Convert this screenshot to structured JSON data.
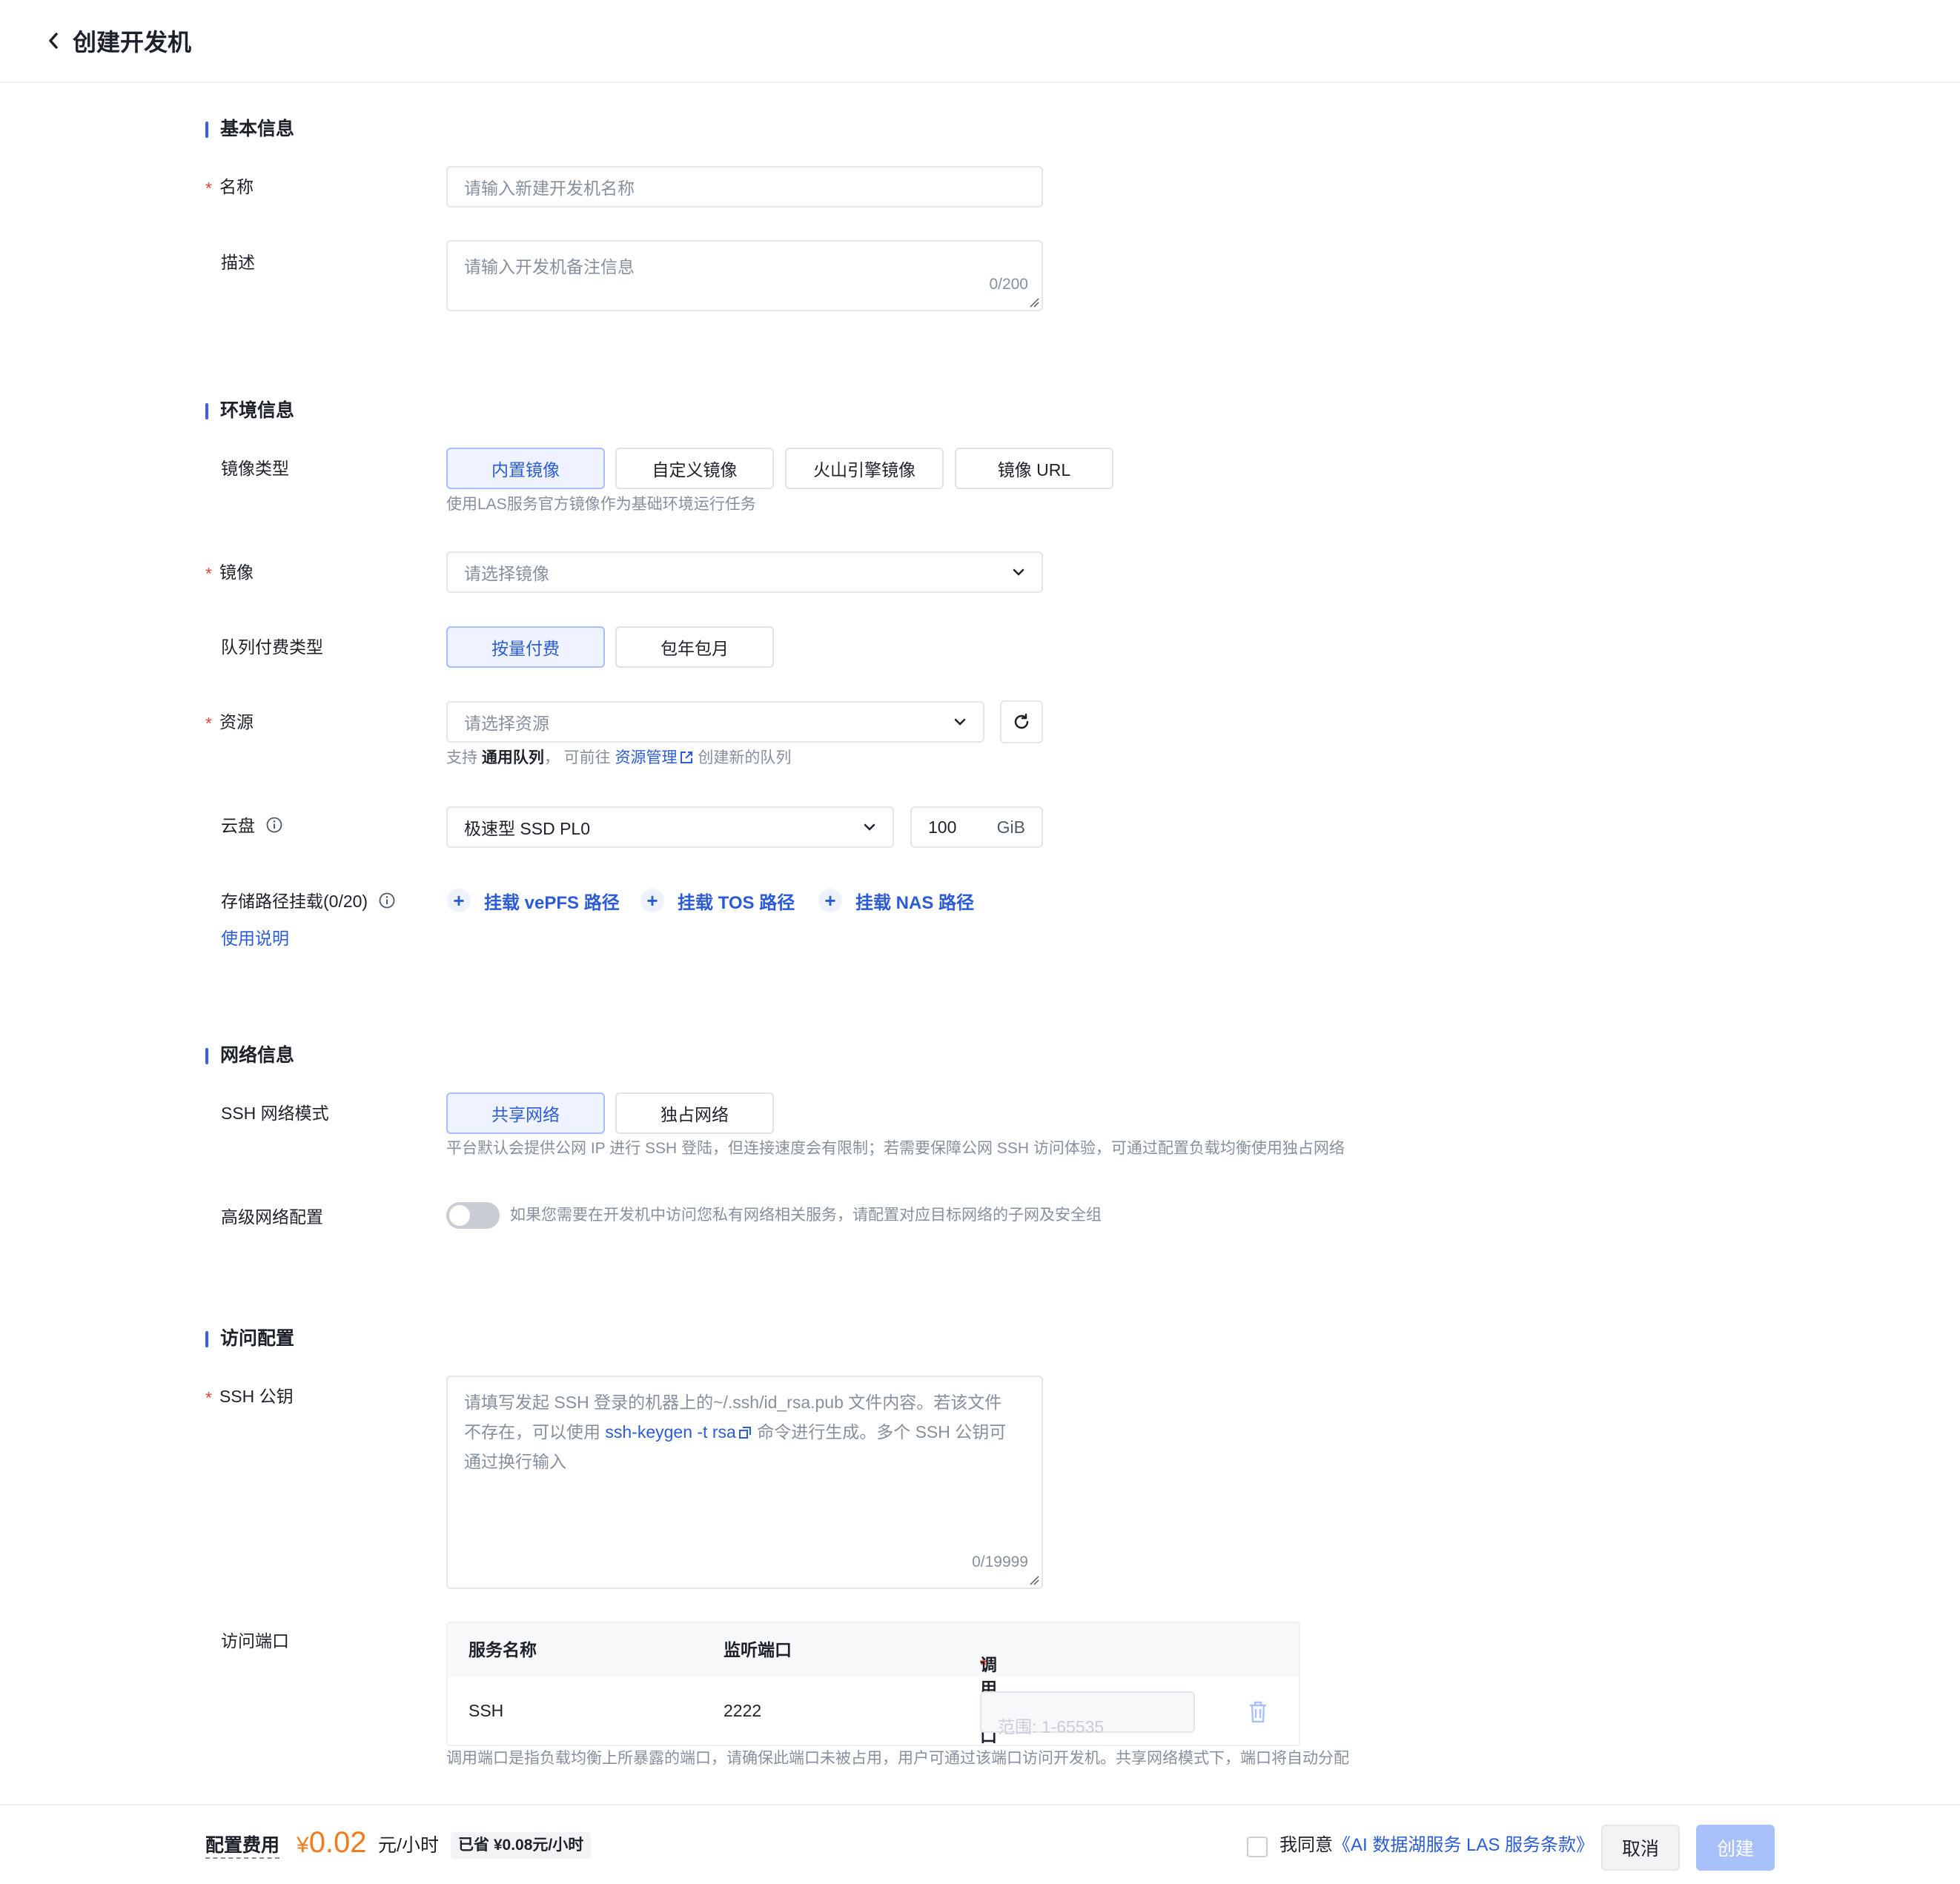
{
  "header": {
    "title": "创建开发机"
  },
  "sections": {
    "basic": "基本信息",
    "env": "环境信息",
    "network": "网络信息",
    "access": "访问配置"
  },
  "basic": {
    "name_label": "名称",
    "name_placeholder": "请输入新建开发机名称",
    "desc_label": "描述",
    "desc_placeholder": "请输入开发机备注信息",
    "desc_counter": "0/200"
  },
  "env": {
    "image_type_label": "镜像类型",
    "image_types": [
      "内置镜像",
      "自定义镜像",
      "火山引擎镜像",
      "镜像 URL"
    ],
    "image_type_hint": "使用LAS服务官方镜像作为基础环境运行任务",
    "image_label": "镜像",
    "image_placeholder": "请选择镜像",
    "billing_label": "队列付费类型",
    "billing_types": [
      "按量付费",
      "包年包月"
    ],
    "resource_label": "资源",
    "resource_placeholder": "请选择资源",
    "resource_hint_prefix": "支持",
    "resource_hint_bold": "通用队列",
    "resource_hint_mid": "， 可前往",
    "resource_hint_link": "资源管理",
    "resource_hint_suffix": "创建新的队列",
    "disk_label": "云盘",
    "disk_type": "极速型 SSD PL0",
    "disk_size": "100",
    "disk_unit": "GiB",
    "storage_label": "存储路径挂载(0/20)",
    "storage_help": "使用说明",
    "mounts": [
      "挂载 vePFS 路径",
      "挂载 TOS 路径",
      "挂载 NAS 路径"
    ]
  },
  "network": {
    "ssh_mode_label": "SSH 网络模式",
    "ssh_modes": [
      "共享网络",
      "独占网络"
    ],
    "ssh_mode_hint": "平台默认会提供公网 IP 进行 SSH 登陆，但连接速度会有限制；若需要保障公网 SSH 访问体验，可通过配置负载均衡使用独占网络",
    "advanced_label": "高级网络配置",
    "advanced_hint": "如果您需要在开发机中访问您私有网络相关服务，请配置对应目标网络的子网及安全组"
  },
  "access": {
    "ssh_key_label": "SSH 公钥",
    "ssh_key_placeholder_1": "请填写发起 SSH 登录的机器上的~/.ssh/id_rsa.pub 文件内容。若该文件",
    "ssh_key_placeholder_2a": "不存在，可以使用",
    "ssh_key_placeholder_link": "ssh-keygen -t rsa",
    "ssh_key_placeholder_2b": "命令进行生成。多个 SSH 公钥可",
    "ssh_key_placeholder_3": "通过换行输入",
    "ssh_key_counter": "0/19999",
    "port_label": "访问端口",
    "port_columns": [
      "服务名称",
      "监听端口",
      "调用端口"
    ],
    "port_rows": [
      {
        "service": "SSH",
        "listen": "2222",
        "call_placeholder": "范围: 1-65535"
      }
    ],
    "port_hint": "调用端口是指负载均衡上所暴露的端口，请确保此端口未被占用，用户可通过该端口访问开发机。共享网络模式下，端口将自动分配"
  },
  "footer": {
    "fee_label": "配置费用",
    "currency": "¥",
    "price": "0.02",
    "unit": "元/小时",
    "saved": "已省 ¥0.08元/小时",
    "agree_prefix": "我同意",
    "agree_link": "《AI 数据湖服务 LAS 服务条款》",
    "cancel": "取消",
    "create": "创建"
  },
  "colors": {
    "accent": "#2b5bd7",
    "price": "#f07c1e",
    "required": "#e5483a"
  }
}
